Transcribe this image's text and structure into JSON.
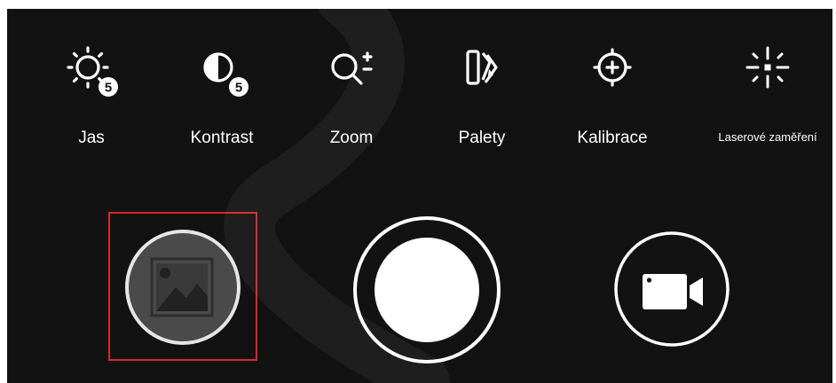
{
  "toolbar": {
    "items": [
      {
        "label": "Jas",
        "icon": "brightness-icon",
        "badge": "5"
      },
      {
        "label": "Kontrast",
        "icon": "contrast-icon",
        "badge": "5"
      },
      {
        "label": "Zoom",
        "icon": "zoom-icon"
      },
      {
        "label": "Palety",
        "icon": "palette-icon"
      },
      {
        "label": "Kalibrace",
        "icon": "calibration-crosshair-icon"
      },
      {
        "label": "Laserové zaměření",
        "icon": "laser-aim-icon"
      }
    ]
  },
  "controls": {
    "gallery": {
      "icon": "gallery-image-icon",
      "highlighted": true
    },
    "shutter": {
      "icon": "shutter-icon"
    },
    "video": {
      "icon": "video-camera-icon"
    }
  },
  "colors": {
    "background": "#121212",
    "foreground": "#ffffff",
    "highlight": "#d8262c",
    "gallery_button_fill": "#4a4a4a",
    "watermark": "#f4f4f4"
  }
}
